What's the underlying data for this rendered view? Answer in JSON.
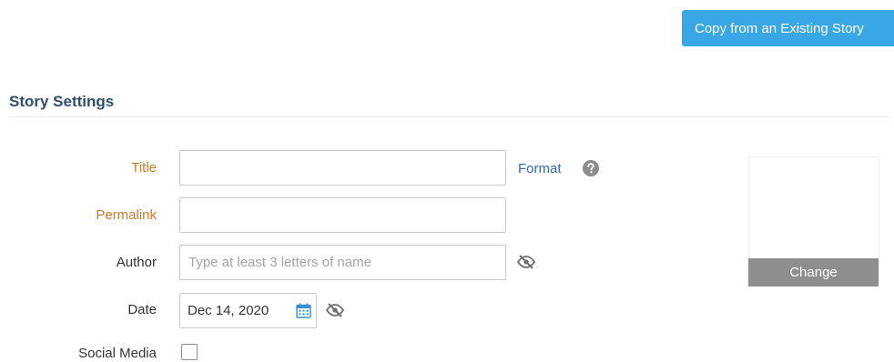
{
  "header": {
    "copy_button_label": "Copy from an Existing Story"
  },
  "section": {
    "title": "Story Settings"
  },
  "form": {
    "title": {
      "label": "Title",
      "value": "",
      "format_link": "Format",
      "help_icon": "question-circle-icon"
    },
    "permalink": {
      "label": "Permalink",
      "value": ""
    },
    "author": {
      "label": "Author",
      "value": "",
      "placeholder": "Type at least 3 letters of name",
      "visibility_icon": "eye-slash-icon"
    },
    "date": {
      "label": "Date",
      "value": "Dec 14, 2020",
      "calendar_icon": "calendar-icon",
      "visibility_icon": "eye-slash-icon"
    },
    "social_media": {
      "label": "Social Media",
      "checked": false
    }
  },
  "image_panel": {
    "change_label": "Change"
  },
  "colors": {
    "primary_button": "#38a7e3",
    "required_label": "#c87b2e",
    "section_title": "#2e4f6e",
    "link": "#2e6da4",
    "change_button": "#8e8e8e"
  }
}
